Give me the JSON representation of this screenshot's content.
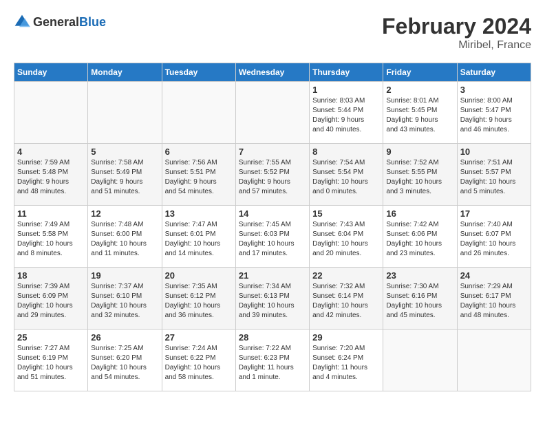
{
  "header": {
    "logo_general": "General",
    "logo_blue": "Blue",
    "month": "February 2024",
    "location": "Miribel, France"
  },
  "weekdays": [
    "Sunday",
    "Monday",
    "Tuesday",
    "Wednesday",
    "Thursday",
    "Friday",
    "Saturday"
  ],
  "weeks": [
    [
      {
        "day": "",
        "info": ""
      },
      {
        "day": "",
        "info": ""
      },
      {
        "day": "",
        "info": ""
      },
      {
        "day": "",
        "info": ""
      },
      {
        "day": "1",
        "info": "Sunrise: 8:03 AM\nSunset: 5:44 PM\nDaylight: 9 hours\nand 40 minutes."
      },
      {
        "day": "2",
        "info": "Sunrise: 8:01 AM\nSunset: 5:45 PM\nDaylight: 9 hours\nand 43 minutes."
      },
      {
        "day": "3",
        "info": "Sunrise: 8:00 AM\nSunset: 5:47 PM\nDaylight: 9 hours\nand 46 minutes."
      }
    ],
    [
      {
        "day": "4",
        "info": "Sunrise: 7:59 AM\nSunset: 5:48 PM\nDaylight: 9 hours\nand 48 minutes."
      },
      {
        "day": "5",
        "info": "Sunrise: 7:58 AM\nSunset: 5:49 PM\nDaylight: 9 hours\nand 51 minutes."
      },
      {
        "day": "6",
        "info": "Sunrise: 7:56 AM\nSunset: 5:51 PM\nDaylight: 9 hours\nand 54 minutes."
      },
      {
        "day": "7",
        "info": "Sunrise: 7:55 AM\nSunset: 5:52 PM\nDaylight: 9 hours\nand 57 minutes."
      },
      {
        "day": "8",
        "info": "Sunrise: 7:54 AM\nSunset: 5:54 PM\nDaylight: 10 hours\nand 0 minutes."
      },
      {
        "day": "9",
        "info": "Sunrise: 7:52 AM\nSunset: 5:55 PM\nDaylight: 10 hours\nand 3 minutes."
      },
      {
        "day": "10",
        "info": "Sunrise: 7:51 AM\nSunset: 5:57 PM\nDaylight: 10 hours\nand 5 minutes."
      }
    ],
    [
      {
        "day": "11",
        "info": "Sunrise: 7:49 AM\nSunset: 5:58 PM\nDaylight: 10 hours\nand 8 minutes."
      },
      {
        "day": "12",
        "info": "Sunrise: 7:48 AM\nSunset: 6:00 PM\nDaylight: 10 hours\nand 11 minutes."
      },
      {
        "day": "13",
        "info": "Sunrise: 7:47 AM\nSunset: 6:01 PM\nDaylight: 10 hours\nand 14 minutes."
      },
      {
        "day": "14",
        "info": "Sunrise: 7:45 AM\nSunset: 6:03 PM\nDaylight: 10 hours\nand 17 minutes."
      },
      {
        "day": "15",
        "info": "Sunrise: 7:43 AM\nSunset: 6:04 PM\nDaylight: 10 hours\nand 20 minutes."
      },
      {
        "day": "16",
        "info": "Sunrise: 7:42 AM\nSunset: 6:06 PM\nDaylight: 10 hours\nand 23 minutes."
      },
      {
        "day": "17",
        "info": "Sunrise: 7:40 AM\nSunset: 6:07 PM\nDaylight: 10 hours\nand 26 minutes."
      }
    ],
    [
      {
        "day": "18",
        "info": "Sunrise: 7:39 AM\nSunset: 6:09 PM\nDaylight: 10 hours\nand 29 minutes."
      },
      {
        "day": "19",
        "info": "Sunrise: 7:37 AM\nSunset: 6:10 PM\nDaylight: 10 hours\nand 32 minutes."
      },
      {
        "day": "20",
        "info": "Sunrise: 7:35 AM\nSunset: 6:12 PM\nDaylight: 10 hours\nand 36 minutes."
      },
      {
        "day": "21",
        "info": "Sunrise: 7:34 AM\nSunset: 6:13 PM\nDaylight: 10 hours\nand 39 minutes."
      },
      {
        "day": "22",
        "info": "Sunrise: 7:32 AM\nSunset: 6:14 PM\nDaylight: 10 hours\nand 42 minutes."
      },
      {
        "day": "23",
        "info": "Sunrise: 7:30 AM\nSunset: 6:16 PM\nDaylight: 10 hours\nand 45 minutes."
      },
      {
        "day": "24",
        "info": "Sunrise: 7:29 AM\nSunset: 6:17 PM\nDaylight: 10 hours\nand 48 minutes."
      }
    ],
    [
      {
        "day": "25",
        "info": "Sunrise: 7:27 AM\nSunset: 6:19 PM\nDaylight: 10 hours\nand 51 minutes."
      },
      {
        "day": "26",
        "info": "Sunrise: 7:25 AM\nSunset: 6:20 PM\nDaylight: 10 hours\nand 54 minutes."
      },
      {
        "day": "27",
        "info": "Sunrise: 7:24 AM\nSunset: 6:22 PM\nDaylight: 10 hours\nand 58 minutes."
      },
      {
        "day": "28",
        "info": "Sunrise: 7:22 AM\nSunset: 6:23 PM\nDaylight: 11 hours\nand 1 minute."
      },
      {
        "day": "29",
        "info": "Sunrise: 7:20 AM\nSunset: 6:24 PM\nDaylight: 11 hours\nand 4 minutes."
      },
      {
        "day": "",
        "info": ""
      },
      {
        "day": "",
        "info": ""
      }
    ]
  ]
}
